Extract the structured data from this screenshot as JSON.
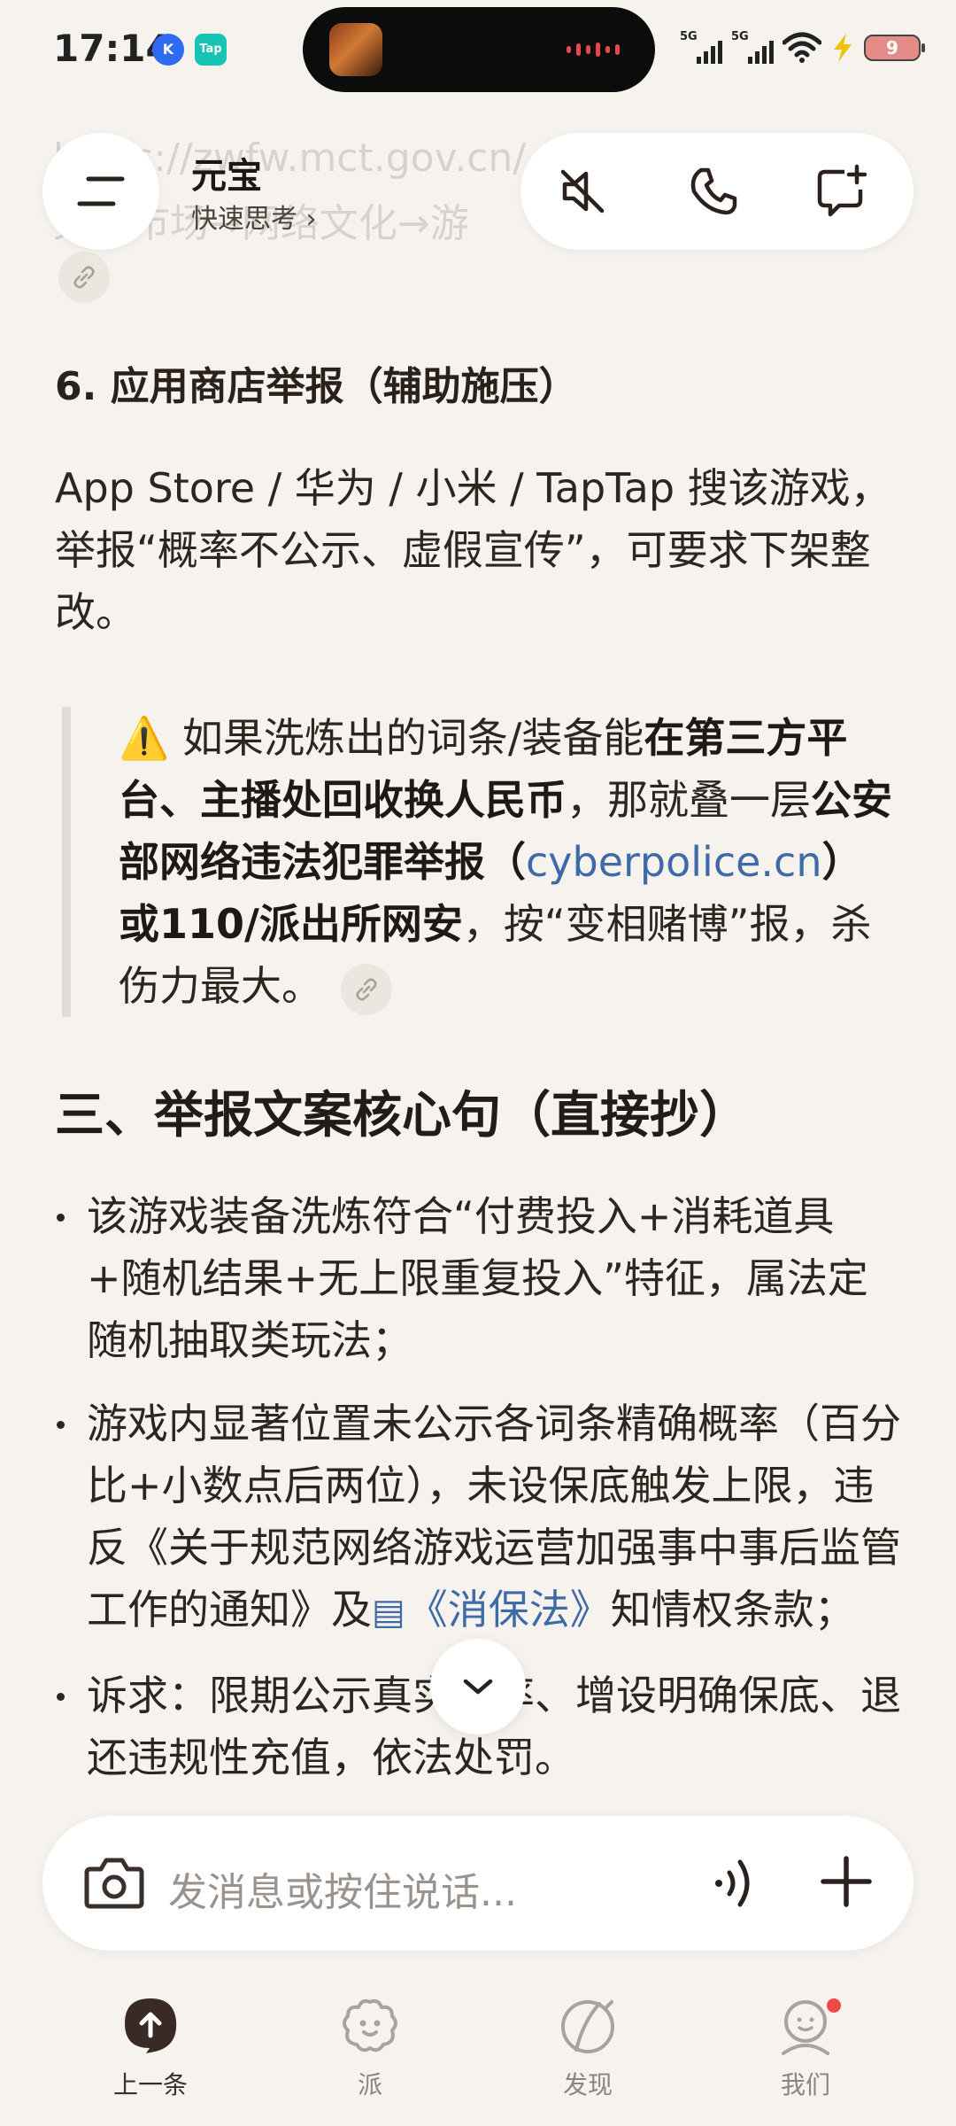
{
  "status_bar": {
    "time": "17:14",
    "app_icon_1": "K",
    "app_icon_2": "Tap",
    "signal_1_label": "5G",
    "signal_2_label": "5G",
    "battery_level": "9",
    "icons": [
      "signal-icon",
      "wifi-icon",
      "charging-icon",
      "battery-icon"
    ]
  },
  "background_faded": {
    "line1": "https://zwfw.mct.gov.cn/（",
    "line2": "文化市场→网络文化→游"
  },
  "header": {
    "title": "元宝",
    "subtitle": "快速思考 ›",
    "menu_icon": "menu-icon",
    "actions": [
      "mute-icon",
      "phone-icon",
      "new-chat-icon"
    ]
  },
  "content": {
    "section6_title": "6. 应用商店举报（辅助施压）",
    "section6_body": "App Store / 华为 / 小米 / TapTap 搜该游戏，举报“概率不公示、虚假宣传”，可要求下架整改。",
    "quote": {
      "icon": "⚠️",
      "t1": " 如果洗炼出的词条/装备能",
      "b1": "在第三方平台、主播处回收换人民币",
      "t2": "，那就叠一层",
      "b2a": "公安部网络违法犯罪举报（",
      "link": "cyberpolice.cn",
      "b2b": "）或110/派出所网安",
      "t3": "，按“变相赌博”报，杀伤力最大。"
    },
    "section3_title": "三、举报文案核心句（直接抄）",
    "bullets": {
      "b1": "该游戏装备洗炼符合“付费投入+消耗道具+随机结果+无上限重复投入”特征，属法定随机抽取类玩法；",
      "b2_pre": "游戏内显著位置未公示各词条精确概率（百分比+小数点后两位），未设保底触发上限，违反《关于规范网络游戏运营加强事中事后监管工作的通知》及",
      "b2_link": "《消保法》",
      "b2_post": "知情权条款；",
      "b3": "诉求：限期公示真实概率、增设明确保底、退还违规性充值，依法处罚。"
    }
  },
  "composer": {
    "placeholder": "发消息或按住说话...",
    "camera_icon": "camera-icon",
    "voice_icon": "voice-wave-icon",
    "plus_icon": "plus-icon"
  },
  "bottom_nav": {
    "items": [
      {
        "label": "上一条",
        "icon": "arrow-up-icon"
      },
      {
        "label": "派",
        "icon": "flower-icon"
      },
      {
        "label": "发现",
        "icon": "compass-icon"
      },
      {
        "label": "我们",
        "icon": "profile-icon"
      }
    ]
  },
  "colors": {
    "background": "#f6f3ef",
    "link": "#3f6aa8",
    "notification_dot": "#f04848"
  }
}
